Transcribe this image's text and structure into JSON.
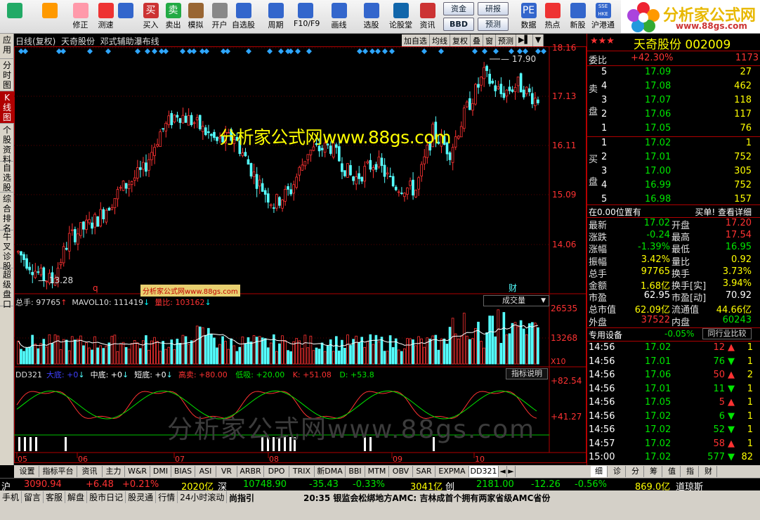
{
  "toolbar": {
    "items": [
      {
        "label": "",
        "icon": "windows-grid-icon"
      },
      {
        "label": "",
        "icon": "back-arrow-icon"
      },
      {
        "label": "修正",
        "icon": "up-down-icon"
      },
      {
        "label": "测速",
        "icon": "speed-icon"
      },
      {
        "label": "",
        "icon": "clock-icon"
      },
      {
        "label": "买入",
        "icon": "buy-icon",
        "glyph": "买"
      },
      {
        "label": "卖出",
        "icon": "sell-icon",
        "glyph": "卖"
      },
      {
        "label": "模拟",
        "icon": "hammer-icon"
      },
      {
        "label": "开户",
        "icon": "lock-icon"
      },
      {
        "label": "自选股",
        "icon": "star-folder-icon"
      },
      {
        "label": "周期",
        "icon": "cycle-icon"
      },
      {
        "label": "F10/F9",
        "icon": "f10-icon"
      },
      {
        "label": "画线",
        "icon": "pen-icon"
      },
      {
        "label": "选股",
        "icon": "select-stock-icon"
      },
      {
        "label": "论股堂",
        "icon": "forum-icon"
      },
      {
        "label": "资讯",
        "icon": "news-icon"
      },
      {
        "label": "数据",
        "icon": "pe-icon",
        "glyph": "PE"
      },
      {
        "label": "热点",
        "icon": "hot-icon"
      },
      {
        "label": "新股",
        "icon": "new-stock-icon"
      },
      {
        "label": "沪港通",
        "icon": "hk-connect-icon",
        "glyph": "SSE HKE"
      }
    ],
    "small_buttons": [
      "资金",
      "研报",
      "BBD",
      "预测"
    ],
    "logo_text": "分析家公式网",
    "logo_url": "www.88gs.com"
  },
  "leftnav": [
    "应用",
    "分时图",
    "K线图",
    "个股资料",
    "自选股",
    "综合排名",
    "牛叉诊股",
    "超级盘口"
  ],
  "chart": {
    "title": "日线(复权)  天奇股份  邓式辅助瀑布线",
    "buttons": [
      "加自选",
      "均线",
      "复权",
      "叠",
      "窗",
      "预测",
      "▶▌",
      "▼"
    ],
    "price_axis": [
      "18.16",
      "17.13",
      "16.11",
      "15.09",
      "14.06"
    ],
    "high_label": "17.90",
    "low_label": "13.28",
    "marker_q": "q",
    "marker_cai": "财",
    "watermark_top": "分析家公式网www.88gs.com",
    "watermark_small": "分析家公式网www.88gs.com",
    "watermark_bottom": "分析家公式网www.88gs.com",
    "vol_panel": {
      "total": "总手: 97765",
      "mavol": "MAVOL10: 111419",
      "liangbi": "量比: 103162",
      "selector": "成交量",
      "axis": [
        "26535",
        "13268",
        "X10"
      ]
    },
    "ind_panel": {
      "name": "DD321",
      "items": [
        {
          "label": "大底: +0",
          "color": "#4040ff"
        },
        {
          "label": "中底: +0",
          "color": "#ffffff"
        },
        {
          "label": "短底: +0",
          "color": "#ffffff"
        },
        {
          "label": "高卖: +80.00",
          "color": "#ff3232"
        },
        {
          "label": "低吸: +20.00",
          "color": "#00e600"
        },
        {
          "label": "K: +51.08",
          "color": "#ff3232"
        },
        {
          "label": "D: +53.8",
          "color": "#00e600"
        }
      ],
      "help_button": "指标说明",
      "axis": [
        "+82.54",
        "+41.27"
      ]
    },
    "months": [
      "05",
      "06",
      "07",
      "08",
      "09",
      "10"
    ]
  },
  "quote": {
    "title": "天奇股份  002009",
    "weibi_label": "委比",
    "weibi_value": "+42.30%",
    "weibi_diff": "1173",
    "sell_label": [
      "卖",
      "盘"
    ],
    "buy_label": [
      "买",
      "盘"
    ],
    "sell": [
      {
        "n": "5",
        "p": "17.09",
        "v": "27"
      },
      {
        "n": "4",
        "p": "17.08",
        "v": "462"
      },
      {
        "n": "3",
        "p": "17.07",
        "v": "118"
      },
      {
        "n": "2",
        "p": "17.06",
        "v": "117"
      },
      {
        "n": "1",
        "p": "17.05",
        "v": "76"
      }
    ],
    "buy": [
      {
        "n": "1",
        "p": "17.02",
        "v": "1"
      },
      {
        "n": "2",
        "p": "17.01",
        "v": "752"
      },
      {
        "n": "3",
        "p": "17.00",
        "v": "305"
      },
      {
        "n": "4",
        "p": "16.99",
        "v": "752"
      },
      {
        "n": "5",
        "p": "16.98",
        "v": "157"
      }
    ],
    "position": "在0.00位置有",
    "detail_link": "买单! 查看详细",
    "stats": [
      {
        "l1": "最新",
        "v1": "17.02",
        "c1": "grn",
        "l2": "开盘",
        "v2": "17.20",
        "c2": "red"
      },
      {
        "l1": "涨跌",
        "v1": "-0.24",
        "c1": "grn",
        "l2": "最高",
        "v2": "17.54",
        "c2": "red"
      },
      {
        "l1": "涨幅",
        "v1": "-1.39%",
        "c1": "grn",
        "l2": "最低",
        "v2": "16.95",
        "c2": "grn"
      },
      {
        "l1": "振幅",
        "v1": "3.42%",
        "c1": "yel",
        "l2": "量比",
        "v2": "0.92",
        "c2": "yel"
      },
      {
        "l1": "总手",
        "v1": "97765",
        "c1": "yel",
        "l2": "换手",
        "v2": "3.73%",
        "c2": "yel"
      },
      {
        "l1": "金额",
        "v1": "1.68亿",
        "c1": "yel",
        "l2": "换手[实]",
        "v2": "3.94%",
        "c2": "yel"
      },
      {
        "l1": "市盈",
        "v1": "62.95",
        "c1": "wht",
        "l2": "市盈[动]",
        "v2": "70.92",
        "c2": "wht"
      },
      {
        "l1": "总市值",
        "v1": "62.09亿",
        "c1": "yel",
        "l2": "流通值",
        "v2": "44.66亿",
        "c2": "yel"
      },
      {
        "l1": "外盘",
        "v1": "37522",
        "c1": "red",
        "l2": "内盘",
        "v2": "60243",
        "c2": "grn"
      }
    ],
    "zhuanyong": "专用设备",
    "zhuanyong_pct": "-0.05%",
    "compare_btn": "同行业比较",
    "ticks": [
      {
        "t": "14:56",
        "p": "17.02",
        "v": "12",
        "d": "up"
      },
      {
        "t": "14:56",
        "p": "17.01",
        "v": "76",
        "d": "down"
      },
      {
        "t": "14:56",
        "p": "17.06",
        "v": "50",
        "d": "up"
      },
      {
        "t": "14:56",
        "p": "17.01",
        "v": "11",
        "d": "down"
      },
      {
        "t": "14:56",
        "p": "17.05",
        "v": "5",
        "d": "up"
      },
      {
        "t": "14:56",
        "p": "17.02",
        "v": "6",
        "d": "down"
      },
      {
        "t": "14:56",
        "p": "17.02",
        "v": "52",
        "d": "down"
      },
      {
        "t": "14:57",
        "p": "17.02",
        "v": "58",
        "d": "up"
      },
      {
        "t": "15:00",
        "p": "17.02",
        "v": "577",
        "d": "down"
      }
    ],
    "tick_extra": [
      "1",
      "1",
      "2",
      "1",
      "1",
      "1",
      "1",
      "1",
      "82"
    ]
  },
  "tabs": [
    "设置",
    "指标平台",
    "资讯",
    "主力",
    "W&R",
    "DMI",
    "BIAS",
    "ASI",
    "VR",
    "ARBR",
    "DPO",
    "TRIX",
    "新DMA",
    "BBI",
    "MTM",
    "OBV",
    "SAR",
    "EXPMA",
    "DD321",
    "◄",
    "►"
  ],
  "active_tab": "DD321",
  "right_tabs": [
    "细",
    "诊",
    "分",
    "筹",
    "值",
    "指",
    "财"
  ],
  "index_bar": {
    "sh_label": "沪",
    "sh": "3090.94",
    "sh_chg": "+6.48",
    "sh_pct": "+0.21%",
    "sh_amt": "2020亿",
    "sz_label": "深",
    "sz": "10748.90",
    "sz_chg": "-35.43",
    "sz_pct": "-0.33%",
    "sz_amt": "3041亿",
    "cy_label": "创",
    "cy": "2181.00",
    "cy_chg": "-12.26",
    "cy_pct": "-0.56%",
    "cy_amt": "869.0亿",
    "dq_label": "道琼斯"
  },
  "status": {
    "buttons": [
      "手机",
      "留言",
      "客服",
      "解盘",
      "股市日记",
      "股灵通",
      "行情",
      "24小时滚动"
    ],
    "ticker_left": "尚指引",
    "news": "20:35 银监会松绑地方AMC: 吉林成首个拥有两家省级AMC省份"
  },
  "chart_data": {
    "type": "candlestick",
    "price_range": [
      13.0,
      18.3
    ],
    "high": 17.9,
    "low": 13.28
  }
}
